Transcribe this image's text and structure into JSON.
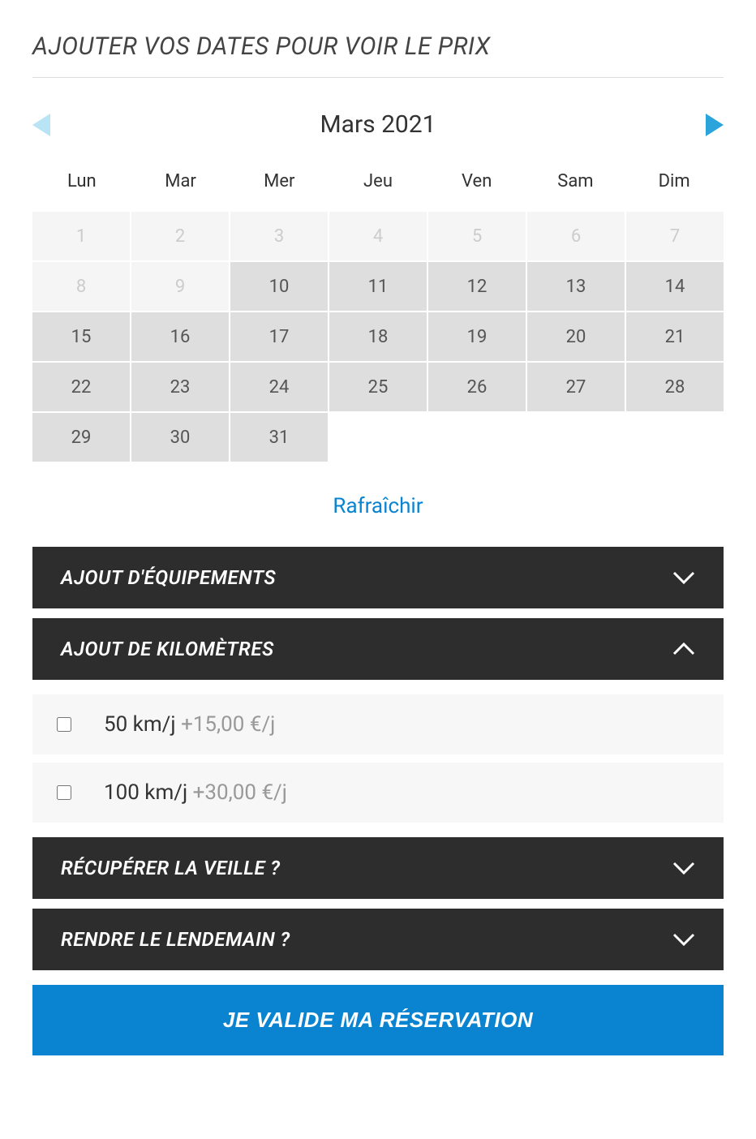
{
  "title": "AJOUTER VOS DATES POUR VOIR LE PRIX",
  "calendar": {
    "month_label": "Mars 2021",
    "day_headers": [
      "Lun",
      "Mar",
      "Mer",
      "Jeu",
      "Ven",
      "Sam",
      "Dim"
    ],
    "days": [
      {
        "n": "1",
        "state": "disabled"
      },
      {
        "n": "2",
        "state": "disabled"
      },
      {
        "n": "3",
        "state": "disabled"
      },
      {
        "n": "4",
        "state": "disabled"
      },
      {
        "n": "5",
        "state": "disabled"
      },
      {
        "n": "6",
        "state": "disabled"
      },
      {
        "n": "7",
        "state": "disabled"
      },
      {
        "n": "8",
        "state": "disabled"
      },
      {
        "n": "9",
        "state": "disabled"
      },
      {
        "n": "10",
        "state": "active"
      },
      {
        "n": "11",
        "state": "active"
      },
      {
        "n": "12",
        "state": "active"
      },
      {
        "n": "13",
        "state": "active"
      },
      {
        "n": "14",
        "state": "active"
      },
      {
        "n": "15",
        "state": "active"
      },
      {
        "n": "16",
        "state": "active"
      },
      {
        "n": "17",
        "state": "active"
      },
      {
        "n": "18",
        "state": "active"
      },
      {
        "n": "19",
        "state": "active"
      },
      {
        "n": "20",
        "state": "active"
      },
      {
        "n": "21",
        "state": "active"
      },
      {
        "n": "22",
        "state": "active"
      },
      {
        "n": "23",
        "state": "active"
      },
      {
        "n": "24",
        "state": "active"
      },
      {
        "n": "25",
        "state": "active"
      },
      {
        "n": "26",
        "state": "active"
      },
      {
        "n": "27",
        "state": "active"
      },
      {
        "n": "28",
        "state": "active"
      },
      {
        "n": "29",
        "state": "active"
      },
      {
        "n": "30",
        "state": "active"
      },
      {
        "n": "31",
        "state": "active"
      },
      {
        "n": "",
        "state": "empty"
      },
      {
        "n": "",
        "state": "empty"
      },
      {
        "n": "",
        "state": "empty"
      },
      {
        "n": "",
        "state": "empty"
      }
    ]
  },
  "refresh_label": "Rafraîchir",
  "accordion": {
    "equipment": {
      "title": "AJOUT D'ÉQUIPEMENTS",
      "expanded": false
    },
    "kilometers": {
      "title": "AJOUT DE KILOMÈTRES",
      "expanded": true,
      "options": [
        {
          "label": "50 km/j",
          "price": "+15,00 €/j"
        },
        {
          "label": "100 km/j",
          "price": "+30,00 €/j"
        }
      ]
    },
    "pickup": {
      "title": "RÉCUPÉRER LA VEILLE ?",
      "expanded": false
    },
    "return": {
      "title": "RENDRE LE LENDEMAIN ?",
      "expanded": false
    }
  },
  "submit_label": "JE VALIDE MA RÉSERVATION"
}
